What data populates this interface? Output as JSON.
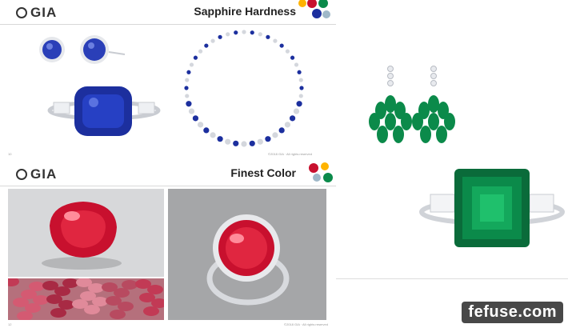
{
  "slide_top": {
    "logo": "GIA",
    "title": "Sapphire Hardness",
    "page_num": "10",
    "footer": "©2018 GIA · All rights reserved"
  },
  "slide_bottom": {
    "logo": "GIA",
    "title": "Finest Color",
    "page_num": "12",
    "footer": "©2018 GIA · All rights reserved"
  },
  "watermark": "fefuse.com",
  "colors": {
    "sapphire": "#1c2f9e",
    "ruby": "#c8102e",
    "emerald": "#0b8a4a",
    "metal": "#c9ccd2"
  }
}
